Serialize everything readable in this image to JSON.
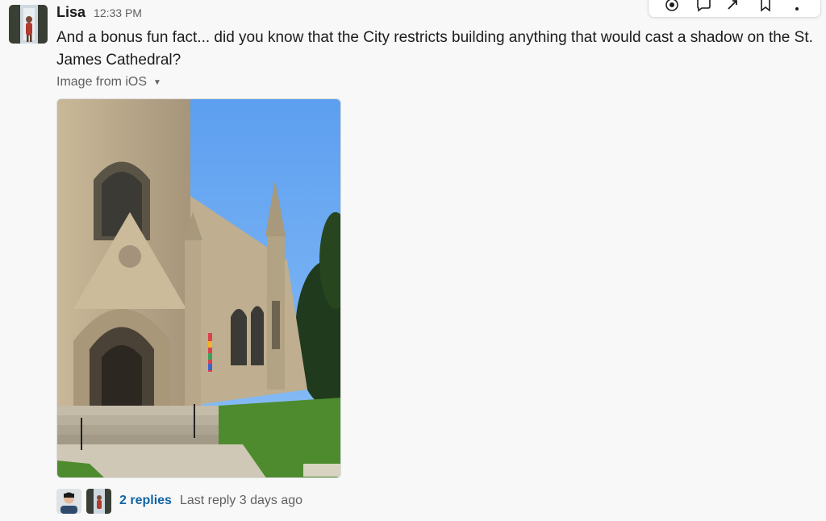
{
  "message": {
    "author": "Lisa",
    "timestamp": "12:33 PM",
    "text": "And a bonus fun fact... did you know that the City restricts building anything that would cast a shadow on the St. James Cathedral?",
    "attachment": {
      "label": "Image from iOS"
    }
  },
  "thread": {
    "reply_count_label": "2 replies",
    "last_reply_label": "Last reply 3 days ago"
  },
  "colors": {
    "link": "#1264a3",
    "muted": "#616061",
    "background": "#f8f8f8"
  },
  "icons": {
    "actions": [
      "emoji-reaction-icon",
      "reply-in-thread-icon",
      "share-icon",
      "bookmark-icon",
      "more-actions-icon"
    ]
  }
}
